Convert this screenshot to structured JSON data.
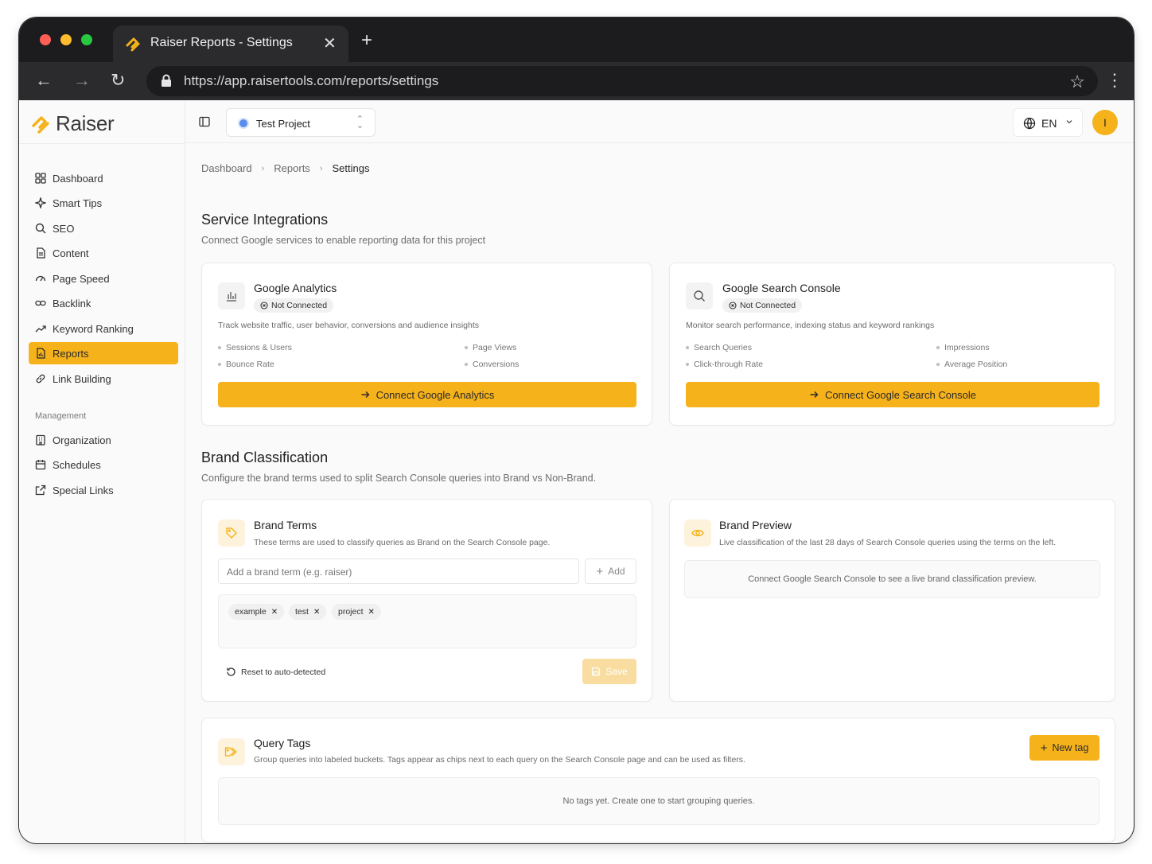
{
  "browser": {
    "tab_title": "Raiser Reports - Settings",
    "url": "https://app.raisertools.com/reports/settings"
  },
  "colors": {
    "accent": "#f6b21b",
    "tab_bar": "#1c1c1e",
    "traffic_red": "#ff5f57",
    "traffic_yellow": "#febc2e",
    "traffic_green": "#28c840"
  },
  "sidebar": {
    "brand": "Raiser",
    "items": [
      {
        "label": "Dashboard",
        "icon": "grid-icon"
      },
      {
        "label": "Smart Tips",
        "icon": "sparkle-icon"
      },
      {
        "label": "SEO",
        "icon": "search-icon"
      },
      {
        "label": "Content",
        "icon": "document-icon"
      },
      {
        "label": "Page Speed",
        "icon": "gauge-icon"
      },
      {
        "label": "Backlink",
        "icon": "link-icon"
      },
      {
        "label": "Keyword Ranking",
        "icon": "trend-icon"
      },
      {
        "label": "Reports",
        "icon": "report-icon",
        "active": true
      },
      {
        "label": "Link Building",
        "icon": "chain-icon"
      }
    ],
    "management_label": "Management",
    "management_items": [
      {
        "label": "Organization",
        "icon": "building-icon"
      },
      {
        "label": "Schedules",
        "icon": "calendar-icon"
      },
      {
        "label": "Special Links",
        "icon": "external-link-icon"
      }
    ]
  },
  "topbar": {
    "project": "Test Project",
    "language": "EN",
    "avatar_initial": "I"
  },
  "breadcrumb": {
    "items": [
      "Dashboard",
      "Reports",
      "Settings"
    ]
  },
  "integrations": {
    "title": "Service Integrations",
    "subtitle": "Connect Google services to enable reporting data for this project",
    "cards": [
      {
        "title": "Google Analytics",
        "status": "Not Connected",
        "description": "Track website traffic, user behavior, conversions and audience insights",
        "features": [
          "Sessions & Users",
          "Page Views",
          "Bounce Rate",
          "Conversions"
        ],
        "button": "Connect Google Analytics"
      },
      {
        "title": "Google Search Console",
        "status": "Not Connected",
        "description": "Monitor search performance, indexing status and keyword rankings",
        "features": [
          "Search Queries",
          "Impressions",
          "Click-through Rate",
          "Average Position"
        ],
        "button": "Connect Google Search Console"
      }
    ]
  },
  "brand": {
    "title": "Brand Classification",
    "subtitle": "Configure the brand terms used to split Search Console queries into Brand vs Non-Brand.",
    "terms": {
      "title": "Brand Terms",
      "description": "These terms are used to classify queries as Brand on the Search Console page.",
      "input_placeholder": "Add a brand term (e.g. raiser)",
      "add_label": "Add",
      "chips": [
        "example",
        "test",
        "project"
      ],
      "reset_label": "Reset to auto-detected",
      "save_label": "Save"
    },
    "preview": {
      "title": "Brand Preview",
      "description": "Live classification of the last 28 days of Search Console queries using the terms on the left.",
      "empty": "Connect Google Search Console to see a live brand classification preview."
    }
  },
  "query_tags": {
    "title": "Query Tags",
    "description": "Group queries into labeled buckets. Tags appear as chips next to each query on the Search Console page and can be used as filters.",
    "new_tag_label": "New tag",
    "empty": "No tags yet. Create one to start grouping queries."
  }
}
